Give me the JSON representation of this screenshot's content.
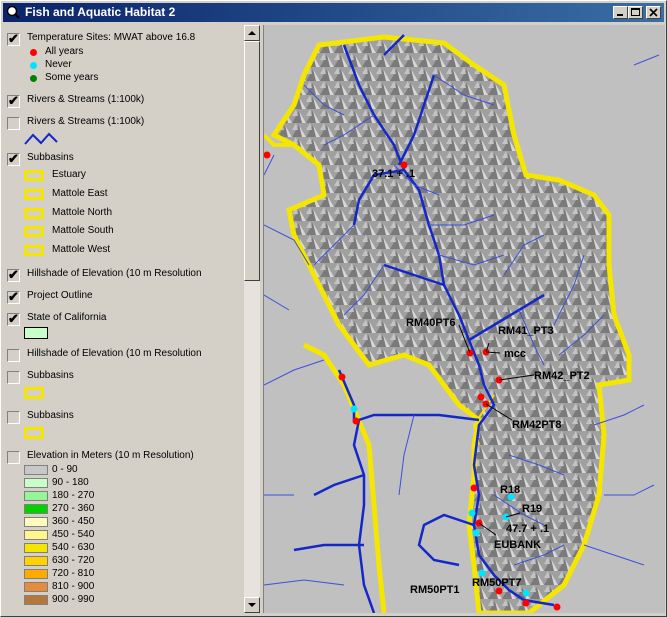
{
  "window": {
    "title": "Fish and Aquatic Habitat 2"
  },
  "toc": {
    "layers": [
      {
        "label": "Temperature Sites: MWAT above 16.8",
        "checked": true
      },
      {
        "label": "Rivers & Streams (1:100k)",
        "checked": true
      },
      {
        "label": "Rivers & Streams (1:100k)",
        "checked": false
      },
      {
        "label": "Subbasins",
        "checked": true
      },
      {
        "label": "Hillshade of Elevation (10 m Resolution",
        "checked": true
      },
      {
        "label": "Project Outline",
        "checked": true
      },
      {
        "label": "State of California",
        "checked": true
      },
      {
        "label": "Hillshade of Elevation (10 m Resolution",
        "checked": false
      },
      {
        "label": "Subbasins",
        "checked": false
      },
      {
        "label": "Subbasins",
        "checked": false
      },
      {
        "label": "Elevation in Meters (10 m Resolution)",
        "checked": false
      }
    ],
    "temp_legend": [
      {
        "label": "All years",
        "color": "#ff0000"
      },
      {
        "label": "Never",
        "color": "#00e5ff"
      },
      {
        "label": "Some years",
        "color": "#008000"
      }
    ],
    "subbasin_legend": [
      "Estuary",
      "Mattole East",
      "Mattole North",
      "Mattole South",
      "Mattole West"
    ],
    "elevation_legend": [
      {
        "label": "0 - 90",
        "color": "#c8c8c8"
      },
      {
        "label": "90 - 180",
        "color": "#c8ffc8"
      },
      {
        "label": "180 - 270",
        "color": "#96f596"
      },
      {
        "label": "270 - 360",
        "color": "#00d200"
      },
      {
        "label": "360 - 450",
        "color": "#fffabe"
      },
      {
        "label": "450 - 540",
        "color": "#fff58c"
      },
      {
        "label": "540 - 630",
        "color": "#f5e600"
      },
      {
        "label": "630 - 720",
        "color": "#ffd200"
      },
      {
        "label": "720 - 810",
        "color": "#ffaa00"
      },
      {
        "label": "810 - 900",
        "color": "#e68c3c"
      },
      {
        "label": "900 - 990",
        "color": "#b4783c"
      }
    ]
  },
  "map": {
    "labels": {
      "l1": "37.1 + .1",
      "l2": "RM40PT6",
      "l3": "RM41_PT3",
      "l4": "mcc",
      "l5": "RM42_PT2",
      "l6": "RM42PT8",
      "l7": "R18",
      "l8": "R19",
      "l9": "47.7 + .1",
      "l10": "EUBANK",
      "l11": "RM50PT1",
      "l12": "RM50PT7"
    }
  }
}
